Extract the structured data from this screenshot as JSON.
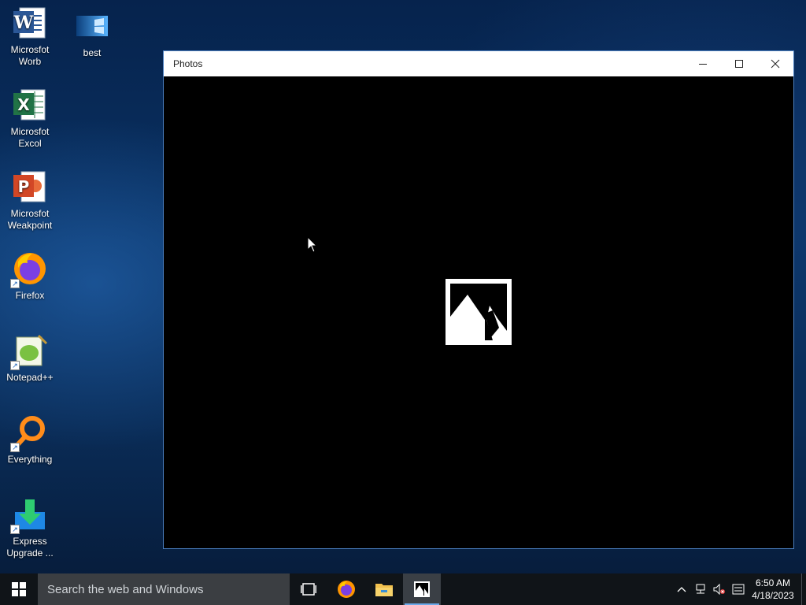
{
  "desktop": {
    "icons": [
      {
        "label": "Microsfot Worb",
        "icon": "word-icon"
      },
      {
        "label": "best",
        "icon": "windows-image-icon"
      },
      {
        "label": "Microsfot Excol",
        "icon": "excel-icon"
      },
      {
        "label": "Microsfot Weakpoint",
        "icon": "powerpoint-icon"
      },
      {
        "label": "Firefox",
        "icon": "firefox-icon"
      },
      {
        "label": "Notepad++",
        "icon": "notepadpp-icon"
      },
      {
        "label": "Everything",
        "icon": "everything-icon"
      },
      {
        "label": "Express Upgrade ...",
        "icon": "download-icon"
      }
    ]
  },
  "window": {
    "title": "Photos",
    "controls": {
      "minimize": "minimize",
      "maximize": "maximize",
      "close": "close"
    },
    "content": {
      "placeholder_icon": "image-placeholder-icon",
      "background": "#000000"
    }
  },
  "taskbar": {
    "search_placeholder": "Search the web and Windows",
    "pinned": [
      {
        "name": "task-view",
        "icon": "task-view-icon"
      },
      {
        "name": "firefox",
        "icon": "firefox-icon"
      },
      {
        "name": "file-explorer",
        "icon": "folder-icon"
      },
      {
        "name": "photos",
        "icon": "photos-icon",
        "active": true
      }
    ],
    "tray": {
      "time": "6:50 AM",
      "date": "4/18/2023"
    }
  },
  "colors": {
    "accent": "#6aa9ea",
    "window_border": "#4a7fc1",
    "taskbar": "#101418"
  }
}
